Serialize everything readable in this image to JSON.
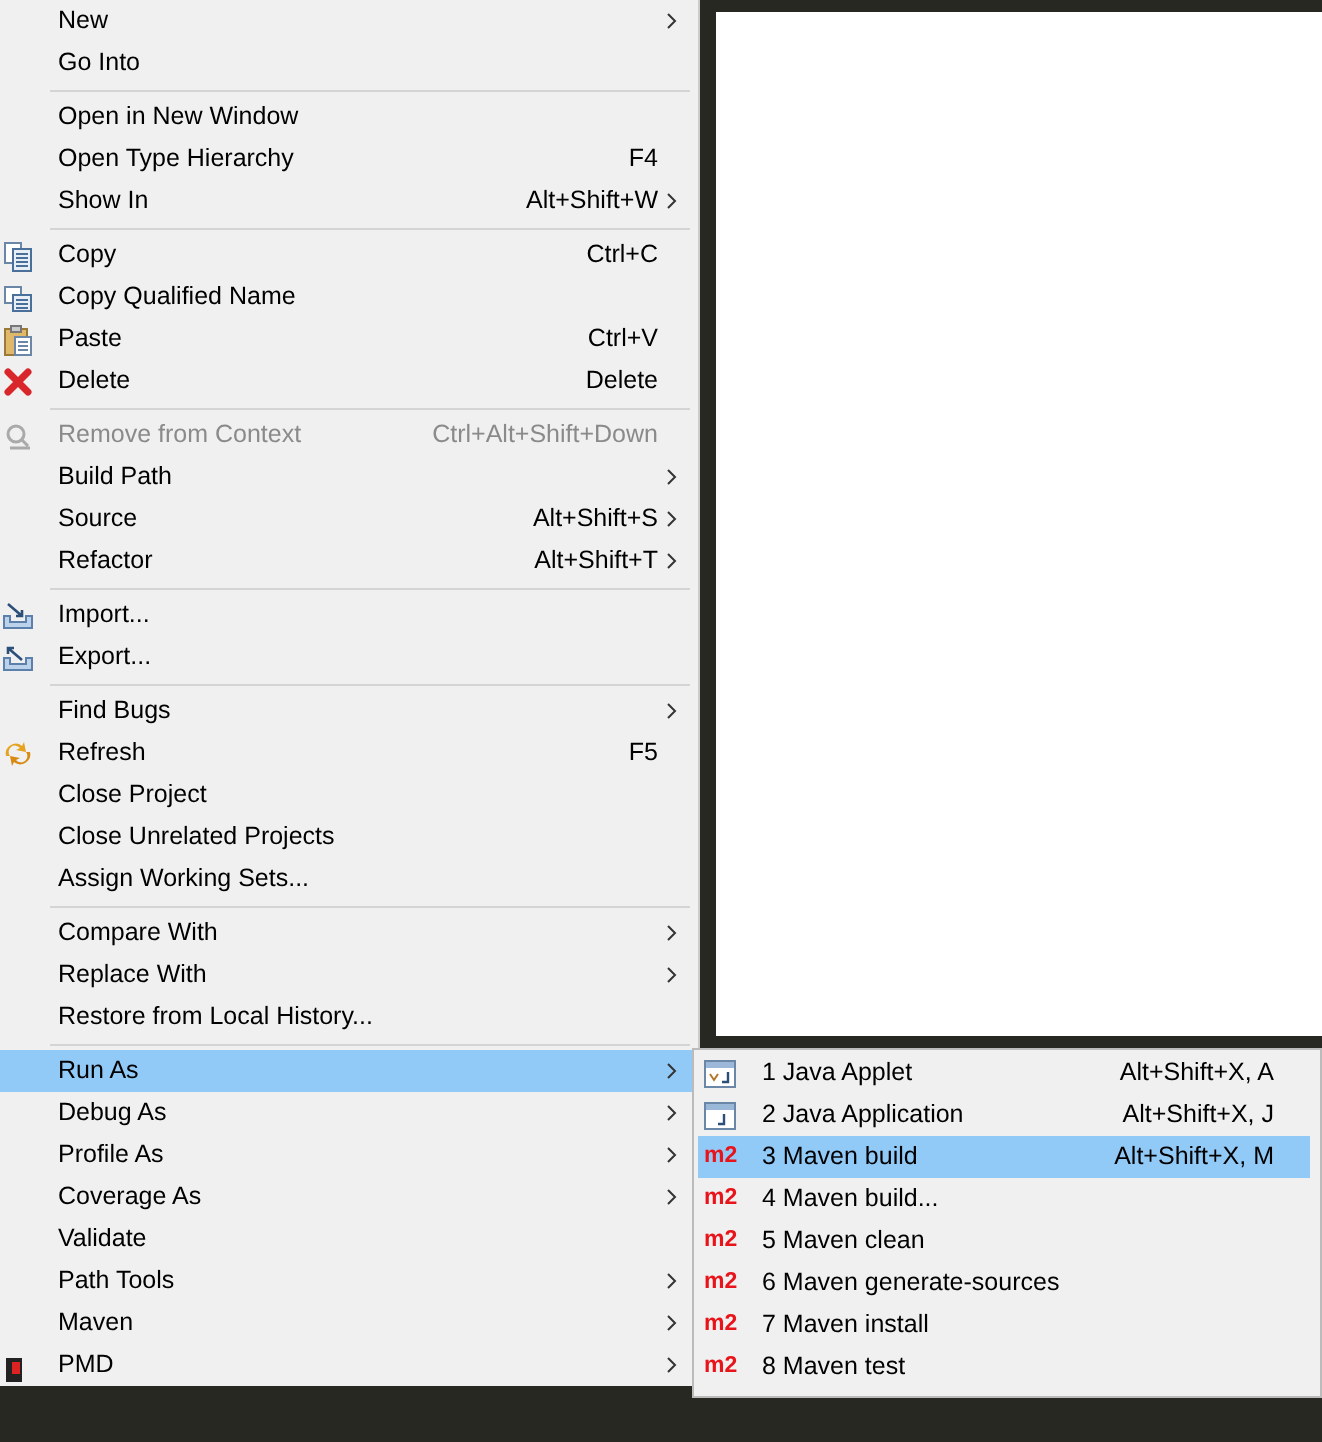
{
  "menu": [
    {
      "kind": "item",
      "label": "New",
      "submenu": true
    },
    {
      "kind": "item",
      "label": "Go Into"
    },
    {
      "kind": "separator"
    },
    {
      "kind": "item",
      "label": "Open in New Window"
    },
    {
      "kind": "item",
      "label": "Open Type Hierarchy",
      "shortcut": "F4"
    },
    {
      "kind": "item",
      "label": "Show In",
      "shortcut": "Alt+Shift+W",
      "submenu": true
    },
    {
      "kind": "separator"
    },
    {
      "kind": "item",
      "label": "Copy",
      "shortcut": "Ctrl+C"
    },
    {
      "kind": "item",
      "label": "Copy Qualified Name"
    },
    {
      "kind": "item",
      "label": "Paste",
      "shortcut": "Ctrl+V"
    },
    {
      "kind": "item",
      "label": "Delete",
      "shortcut": "Delete"
    },
    {
      "kind": "separator"
    },
    {
      "kind": "item",
      "label": "Remove from Context",
      "shortcut": "Ctrl+Alt+Shift+Down",
      "disabled": true
    },
    {
      "kind": "item",
      "label": "Build Path",
      "submenu": true
    },
    {
      "kind": "item",
      "label": "Source",
      "shortcut": "Alt+Shift+S",
      "submenu": true
    },
    {
      "kind": "item",
      "label": "Refactor",
      "shortcut": "Alt+Shift+T",
      "submenu": true
    },
    {
      "kind": "separator"
    },
    {
      "kind": "item",
      "label": "Import..."
    },
    {
      "kind": "item",
      "label": "Export..."
    },
    {
      "kind": "separator"
    },
    {
      "kind": "item",
      "label": "Find Bugs",
      "submenu": true
    },
    {
      "kind": "item",
      "label": "Refresh",
      "shortcut": "F5"
    },
    {
      "kind": "item",
      "label": "Close Project"
    },
    {
      "kind": "item",
      "label": "Close Unrelated Projects"
    },
    {
      "kind": "item",
      "label": "Assign Working Sets..."
    },
    {
      "kind": "separator"
    },
    {
      "kind": "item",
      "label": "Compare With",
      "submenu": true
    },
    {
      "kind": "item",
      "label": "Replace With",
      "submenu": true
    },
    {
      "kind": "item",
      "label": "Restore from Local History..."
    },
    {
      "kind": "separator"
    },
    {
      "kind": "item",
      "label": "Run As",
      "submenu": true,
      "selected": true
    },
    {
      "kind": "item",
      "label": "Debug As",
      "submenu": true
    },
    {
      "kind": "item",
      "label": "Profile As",
      "submenu": true
    },
    {
      "kind": "item",
      "label": "Coverage As",
      "submenu": true
    },
    {
      "kind": "item",
      "label": "Validate"
    },
    {
      "kind": "item",
      "label": "Path Tools",
      "submenu": true
    },
    {
      "kind": "item",
      "label": "Maven",
      "submenu": true
    },
    {
      "kind": "item",
      "label": "PMD",
      "submenu": true
    }
  ],
  "run_as_submenu": [
    {
      "label": "1 Java Applet",
      "shortcut": "Alt+Shift+X, A",
      "selected": false
    },
    {
      "label": "2 Java Application",
      "shortcut": "Alt+Shift+X, J",
      "selected": false
    },
    {
      "label": "3 Maven build",
      "shortcut": "Alt+Shift+X, M",
      "icon_text": "m2",
      "selected": true
    },
    {
      "label": "4 Maven build...",
      "icon_text": "m2",
      "selected": false
    },
    {
      "label": "5 Maven clean",
      "icon_text": "m2",
      "selected": false
    },
    {
      "label": "6 Maven generate-sources",
      "icon_text": "m2",
      "selected": false
    },
    {
      "label": "7 Maven install",
      "icon_text": "m2",
      "selected": false
    },
    {
      "label": "8 Maven test",
      "icon_text": "m2",
      "selected": false
    }
  ]
}
